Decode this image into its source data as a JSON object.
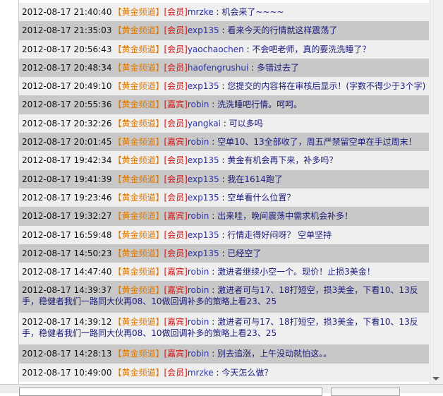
{
  "channel_label": "【黄金频道】",
  "messages": [
    {
      "time": "2012-08-17 21:40:40",
      "rank": "[会员]",
      "user": "mrzke",
      "text": "机会来了~~~~"
    },
    {
      "time": "2012-08-17 21:35:03",
      "rank": "[会员]",
      "user": "exp135",
      "text": "看来今天的行情就这样震荡了"
    },
    {
      "time": "2012-08-17 20:56:43",
      "rank": "[会员]",
      "user": "yaochaochen",
      "text": "不会吧老师，真的要洗洗睡了？"
    },
    {
      "time": "2012-08-17 20:48:34",
      "rank": "[会员]",
      "user": "haofengrushui",
      "text": "多错过去了"
    },
    {
      "time": "2012-08-17 20:49:10",
      "rank": "[会员]",
      "user": "exp135",
      "text": "您提交的内容将在审核后显示！(字数不得少于3个字)"
    },
    {
      "time": "2012-08-17 20:55:36",
      "rank": "[嘉宾]",
      "user": "robin",
      "text": "洗洗睡吧行情。呵呵。"
    },
    {
      "time": "2012-08-17 20:32:26",
      "rank": "[会员]",
      "user": "yangkai",
      "text": "可以多吗"
    },
    {
      "time": "2012-08-17 20:01:45",
      "rank": "[嘉宾]",
      "user": "robin",
      "text": "空单10、13全部收了，周五严禁留空单在手过周末！"
    },
    {
      "time": "2012-08-17 19:42:34",
      "rank": "[会员]",
      "user": "exp135",
      "text": "黄金有机会再下来，补多吗？"
    },
    {
      "time": "2012-08-17 19:41:39",
      "rank": "[会员]",
      "user": "exp135",
      "text": "我在1614跑了"
    },
    {
      "time": "2012-08-17 19:23:46",
      "rank": "[会员]",
      "user": "exp135",
      "text": "空单看什么位置？"
    },
    {
      "time": "2012-08-17 19:32:27",
      "rank": "[嘉宾]",
      "user": "robin",
      "text": "出来哇，晚间震荡中需求机会补多！"
    },
    {
      "time": "2012-08-17 16:59:48",
      "rank": "[会员]",
      "user": "exp135",
      "text": "行情走得好闷呀？ 空单坚持"
    },
    {
      "time": "2012-08-17 14:50:23",
      "rank": "[会员]",
      "user": "exp135",
      "text": "已经空了"
    },
    {
      "time": "2012-08-17 14:47:40",
      "rank": "[嘉宾]",
      "user": "robin",
      "text": "激进者继续小空一个。现价！止损3美金！"
    },
    {
      "time": "2012-08-17 14:39:37",
      "rank": "[嘉宾]",
      "user": "robin",
      "text": "激进者可与17、18打短空，损3美金，下看10、13反手，稳健者我们一路同大伙再08、10做回调补多的策略上看23、25"
    },
    {
      "time": "2012-08-17 14:39:12",
      "rank": "[嘉宾]",
      "user": "robin",
      "text": "激进者可与17、18打短空，损3美金，下看10、13反手，稳健者我们一路同大伙再08、10做回调补多的策略上看23、25"
    },
    {
      "time": "2012-08-17 14:28:13",
      "rank": "[嘉宾]",
      "user": "robin",
      "text": "别去追涨，上午没动就怕这。。"
    },
    {
      "time": "2012-08-17 10:49:00",
      "rank": "[会员]",
      "user": "mrzke",
      "text": "今天怎么做？"
    }
  ]
}
